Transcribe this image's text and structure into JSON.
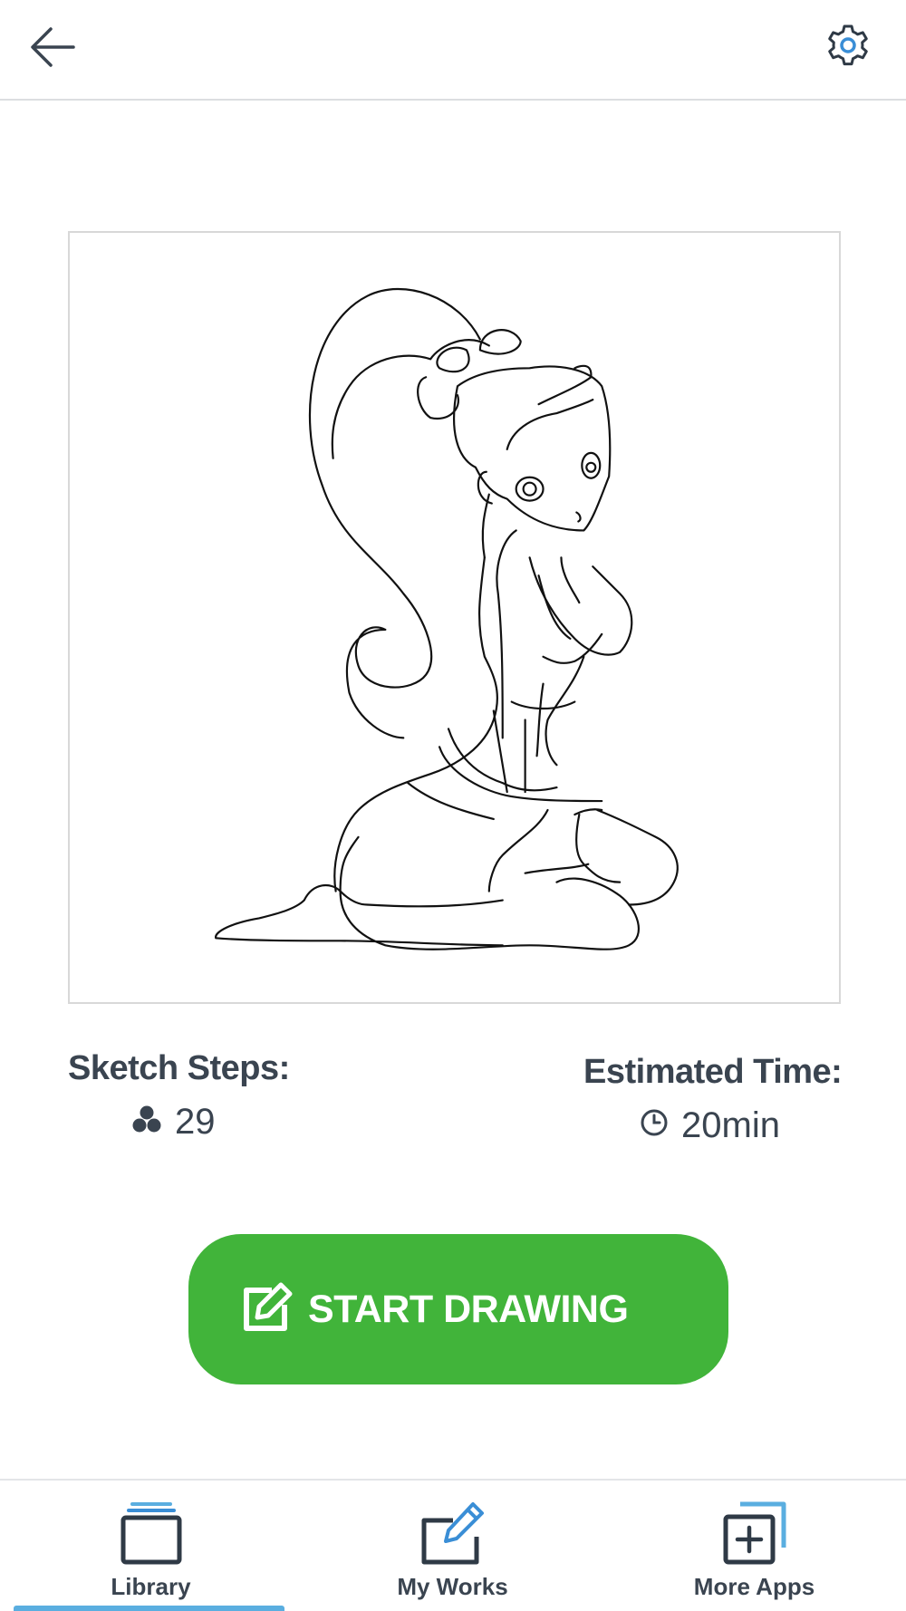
{
  "header": {
    "back_icon": "arrow-left-icon",
    "settings_icon": "gear-icon"
  },
  "preview": {
    "description_icon": "sketch-preview"
  },
  "stats": {
    "steps_label": "Sketch Steps:",
    "steps_value": "29",
    "steps_icon": "layers-dots-icon",
    "time_label": "Estimated Time:",
    "time_value": "20min",
    "time_icon": "clock-icon"
  },
  "action": {
    "start_label": "START DRAWING",
    "start_icon": "edit-icon",
    "color": "#41b43a"
  },
  "nav": {
    "items": [
      {
        "label": "Library",
        "icon": "library-icon",
        "active": true
      },
      {
        "label": "My Works",
        "icon": "my-works-icon",
        "active": false
      },
      {
        "label": "More Apps",
        "icon": "more-apps-icon",
        "active": false
      }
    ],
    "active_color": "#5aaee0"
  }
}
